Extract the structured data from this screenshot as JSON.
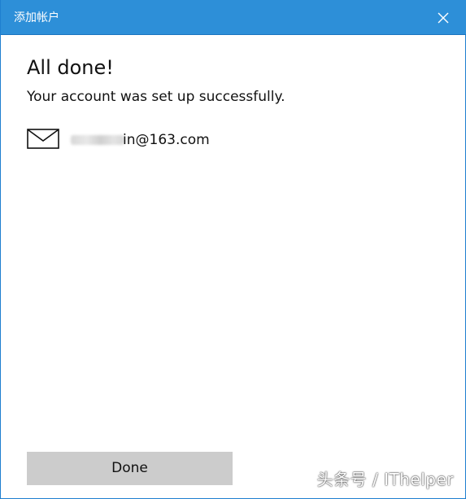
{
  "window": {
    "title": "添加帐户",
    "close_icon": "close-icon",
    "accent_color": "#2d8fd8"
  },
  "content": {
    "heading": "All done!",
    "message": "Your account was set up successfully.",
    "account": {
      "icon": "mail-icon",
      "email_visible": "in@163.com"
    }
  },
  "actions": {
    "done_label": "Done",
    "done_bg_color": "#cccccc"
  },
  "watermark": {
    "text": "头条号 / IThelper"
  }
}
